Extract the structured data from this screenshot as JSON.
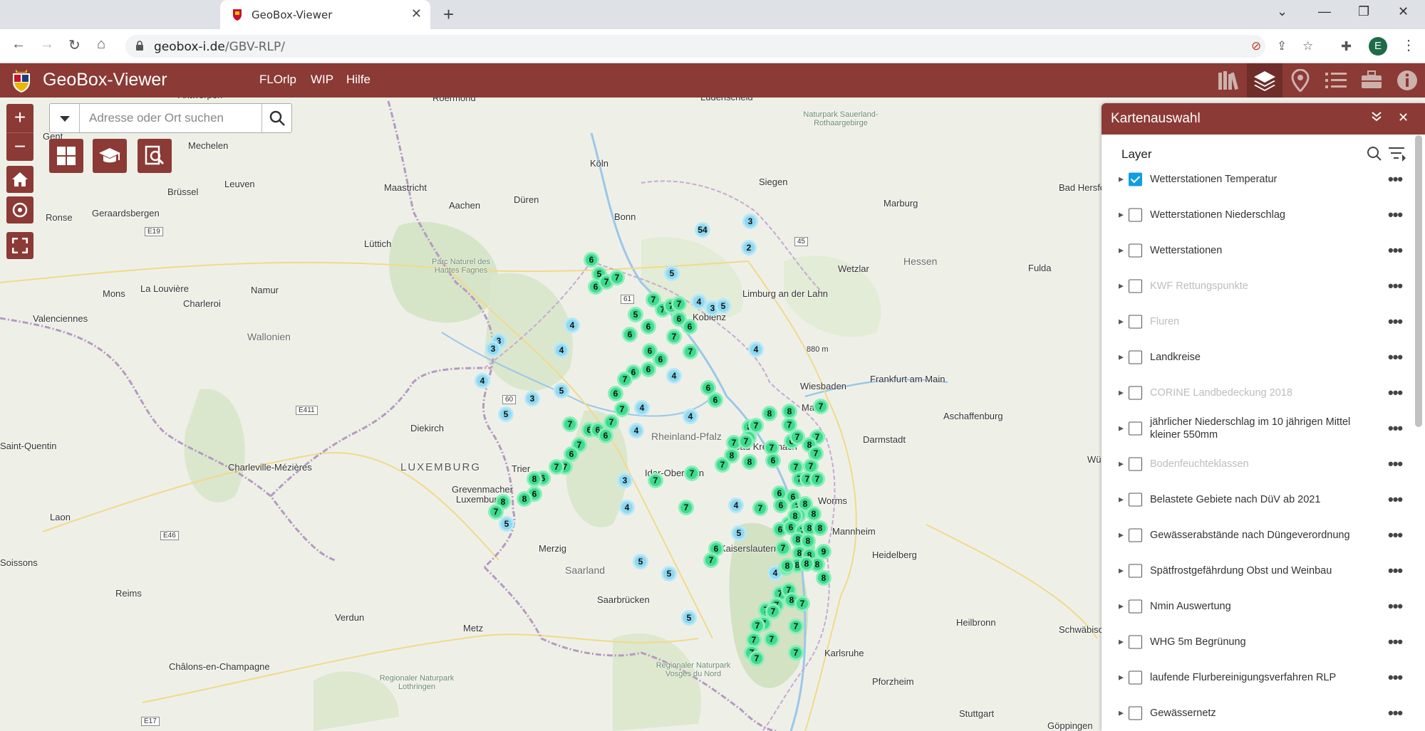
{
  "browser": {
    "tab_title": "GeoBox-Viewer",
    "url_host": "geobox-i.de",
    "url_path": "/GBV-RLP/",
    "profile_initial": "E"
  },
  "app": {
    "title": "GeoBox-Viewer",
    "nav": [
      "FLOrlp",
      "WIP",
      "Hilfe"
    ],
    "accent": "#8b3a35"
  },
  "search": {
    "placeholder": "Adresse oder Ort suchen"
  },
  "panel": {
    "title": "Kartenauswahl",
    "subtitle": "Layer",
    "layers": [
      {
        "label": "Wetterstationen Temperatur",
        "checked": true,
        "enabled": true
      },
      {
        "label": "Wetterstationen Niederschlag",
        "checked": false,
        "enabled": true
      },
      {
        "label": "Wetterstationen",
        "checked": false,
        "enabled": true
      },
      {
        "label": "KWF Rettungspunkte",
        "checked": false,
        "enabled": false
      },
      {
        "label": "Fluren",
        "checked": false,
        "enabled": false
      },
      {
        "label": "Landkreise",
        "checked": false,
        "enabled": true
      },
      {
        "label": "CORINE Landbedeckung 2018",
        "checked": false,
        "enabled": false
      },
      {
        "label": "jährlicher Niederschlag im 10 jährigen Mittel kleiner 550mm",
        "checked": false,
        "enabled": true
      },
      {
        "label": "Bodenfeuchteklassen",
        "checked": false,
        "enabled": false
      },
      {
        "label": "Belastete Gebiete nach DüV ab 2021",
        "checked": false,
        "enabled": true
      },
      {
        "label": "Gewässerabstände nach Düngeverordnung",
        "checked": false,
        "enabled": true
      },
      {
        "label": "Spätfrostgefährdung Obst und Weinbau",
        "checked": false,
        "enabled": true
      },
      {
        "label": "Nmin Auswertung",
        "checked": false,
        "enabled": true
      },
      {
        "label": "WHG 5m Begrünung",
        "checked": false,
        "enabled": true
      },
      {
        "label": "laufende Flurbereinigungsverfahren RLP",
        "checked": false,
        "enabled": true
      },
      {
        "label": "Gewässernetz",
        "checked": false,
        "enabled": true
      }
    ]
  },
  "map": {
    "places": [
      "Roermond",
      "Köln",
      "Siegen",
      "Bonn",
      "Aachen",
      "Düren",
      "Maastricht",
      "Brüssel",
      "Leuven",
      "Mechelen",
      "Gent",
      "Ronse",
      "Geraardsbergen",
      "Lüttich",
      "Namur",
      "Charleroi",
      "La Louvière",
      "Mons",
      "Valenciennes",
      "Wallonien",
      "Parc Naturel des Hautes Fagnes",
      "Koblenz",
      "Limburg an der Lahn",
      "Wetzlar",
      "Marburg",
      "Hessen",
      "Fulda",
      "Bad Hersfeld",
      "Wiesbaden",
      "Mainz",
      "Frankfurt am Main",
      "Aschaffenburg",
      "Darmstadt",
      "Rheinland-Pfalz",
      "Diekirch",
      "LUXEMBURG",
      "Luxemburg",
      "Grevenmacher",
      "Trier",
      "Saint-Quentin",
      "Charleville-Mézières",
      "Laon",
      "Idar-Oberstein",
      "Bad Kreuznach",
      "Worms",
      "Mannheim",
      "Heidelberg",
      "Kaiserslautern",
      "Merzig",
      "Saarland",
      "Saarbrücken",
      "Reims",
      "Verdun",
      "Metz",
      "Heilbronn",
      "Schwäbisch Hall",
      "Karlsruhe",
      "Pforzheim",
      "Stuttgart",
      "Châlons-en-Champagne",
      "Soissons",
      "Würzburg",
      "Lüdenscheid",
      "Naturpark Sauerland-Rothaargebirge",
      "Regionaler Naturpark Lothringen",
      "Regionaler Naturpark Vosges du Nord",
      "Göppingen",
      "Antwerpen"
    ],
    "road_shields": [
      "E19",
      "E411",
      "E46",
      "E17",
      "61",
      "60",
      "45"
    ],
    "elevation": "880 m",
    "markers_cool": [
      [
        "54",
        986,
        323
      ],
      [
        "3",
        1053,
        311
      ],
      [
        "2",
        1051,
        348
      ],
      [
        "5",
        943,
        384
      ],
      [
        "4",
        981,
        424
      ],
      [
        "3",
        1000,
        433
      ],
      [
        "5",
        1015,
        430
      ],
      [
        "3",
        700,
        479
      ],
      [
        "3",
        692,
        490
      ],
      [
        "4",
        803,
        457
      ],
      [
        "4",
        788,
        492
      ],
      [
        "4",
        946,
        528
      ],
      [
        "4",
        1061,
        491
      ],
      [
        "4",
        677,
        535
      ],
      [
        "3",
        747,
        560
      ],
      [
        "5",
        788,
        549
      ],
      [
        "5",
        710,
        582
      ],
      [
        "4",
        901,
        573
      ],
      [
        "4",
        893,
        605
      ],
      [
        "4",
        969,
        585
      ],
      [
        "3",
        877,
        675
      ],
      [
        "4",
        880,
        713
      ],
      [
        "4",
        1033,
        710
      ],
      [
        "5",
        1037,
        749
      ],
      [
        "5",
        899,
        789
      ],
      [
        "5",
        939,
        806
      ],
      [
        "5",
        967,
        868
      ],
      [
        "4",
        1088,
        805
      ],
      [
        "5",
        711,
        736
      ]
    ],
    "markers_warm": [
      [
        "6",
        830,
        365
      ],
      [
        "5",
        841,
        385
      ],
      [
        "6",
        836,
        403
      ],
      [
        "7",
        851,
        396
      ],
      [
        "7",
        866,
        390
      ],
      [
        "7",
        917,
        421
      ],
      [
        "7",
        930,
        435
      ],
      [
        "7",
        942,
        430
      ],
      [
        "7",
        953,
        427
      ],
      [
        "6",
        953,
        448
      ],
      [
        "6",
        968,
        459
      ],
      [
        "5",
        892,
        442
      ],
      [
        "6",
        910,
        459
      ],
      [
        "6",
        884,
        470
      ],
      [
        "7",
        946,
        473
      ],
      [
        "7",
        969,
        494
      ],
      [
        "6",
        912,
        493
      ],
      [
        "6",
        927,
        505
      ],
      [
        "6",
        910,
        519
      ],
      [
        "6",
        889,
        523
      ],
      [
        "7",
        877,
        533
      ],
      [
        "6",
        864,
        553
      ],
      [
        "7",
        873,
        575
      ],
      [
        "7",
        858,
        593
      ],
      [
        "6",
        994,
        545
      ],
      [
        "6",
        1004,
        562
      ],
      [
        "7",
        800,
        596
      ],
      [
        "6",
        827,
        604
      ],
      [
        "6",
        839,
        604
      ],
      [
        "6",
        850,
        612
      ],
      [
        "7",
        813,
        625
      ],
      [
        "6",
        802,
        638
      ],
      [
        "7",
        793,
        656
      ],
      [
        "7",
        781,
        656
      ],
      [
        "6",
        762,
        672
      ],
      [
        "8",
        750,
        673
      ],
      [
        "6",
        750,
        694
      ],
      [
        "8",
        736,
        701
      ],
      [
        "8",
        706,
        705
      ],
      [
        "7",
        696,
        719
      ],
      [
        "7",
        920,
        675
      ],
      [
        "7",
        971,
        665
      ],
      [
        "7",
        963,
        713
      ],
      [
        "8",
        1080,
        581
      ],
      [
        "8",
        1108,
        578
      ],
      [
        "7",
        1152,
        571
      ],
      [
        "8",
        1052,
        600
      ],
      [
        "7",
        1061,
        598
      ],
      [
        "8",
        1051,
        615
      ],
      [
        "7",
        1108,
        597
      ],
      [
        "7",
        1030,
        622
      ],
      [
        "8",
        1027,
        640
      ],
      [
        "7",
        1047,
        620
      ],
      [
        "7",
        1014,
        653
      ],
      [
        "8",
        1052,
        649
      ],
      [
        "7",
        1083,
        629
      ],
      [
        "6",
        1111,
        620
      ],
      [
        "7",
        1119,
        614
      ],
      [
        "7",
        1147,
        614
      ],
      [
        "8",
        1136,
        625
      ],
      [
        "7",
        1145,
        637
      ],
      [
        "6",
        1085,
        647
      ],
      [
        "7",
        1117,
        656
      ],
      [
        "7",
        1138,
        655
      ],
      [
        "7",
        1122,
        673
      ],
      [
        "6",
        1094,
        693
      ],
      [
        "6",
        1113,
        698
      ],
      [
        "7",
        1133,
        673
      ],
      [
        "7",
        1147,
        673
      ],
      [
        "6",
        1096,
        710
      ],
      [
        "7",
        1119,
        712
      ],
      [
        "7",
        1067,
        714
      ],
      [
        "8",
        1130,
        708
      ],
      [
        "7",
        1121,
        724
      ],
      [
        "8",
        1142,
        722
      ],
      [
        "7",
        1107,
        736
      ],
      [
        "8",
        1116,
        725
      ],
      [
        "6",
        1095,
        744
      ],
      [
        "6",
        1110,
        741
      ],
      [
        "7",
        1126,
        746
      ],
      [
        "8",
        1136,
        742
      ],
      [
        "8",
        1151,
        742
      ],
      [
        "6",
        1005,
        771
      ],
      [
        "7",
        998,
        787
      ],
      [
        "7",
        1099,
        770
      ],
      [
        "7",
        1133,
        770
      ],
      [
        "8",
        1120,
        758
      ],
      [
        "8",
        1134,
        760
      ],
      [
        "8",
        1122,
        777
      ],
      [
        "9",
        1156,
        775
      ],
      [
        "8",
        1136,
        780
      ],
      [
        "8",
        1147,
        793
      ],
      [
        "8",
        1119,
        794
      ],
      [
        "8",
        1103,
        798
      ],
      [
        "8",
        1156,
        812
      ],
      [
        "8",
        1132,
        792
      ],
      [
        "8",
        1105,
        795
      ],
      [
        "7",
        1095,
        834
      ],
      [
        "7",
        1107,
        829
      ],
      [
        "8",
        1111,
        843
      ],
      [
        "7",
        1090,
        850
      ],
      [
        "7",
        1075,
        857
      ],
      [
        "7",
        1085,
        859
      ],
      [
        "7",
        1126,
        848
      ],
      [
        "7",
        1072,
        876
      ],
      [
        "7",
        1063,
        879
      ],
      [
        "7",
        1117,
        880
      ],
      [
        "7",
        1058,
        899
      ],
      [
        "7",
        1083,
        898
      ],
      [
        "7",
        1117,
        917
      ],
      [
        "7",
        1055,
        917
      ],
      [
        "7",
        1062,
        925
      ]
    ]
  }
}
